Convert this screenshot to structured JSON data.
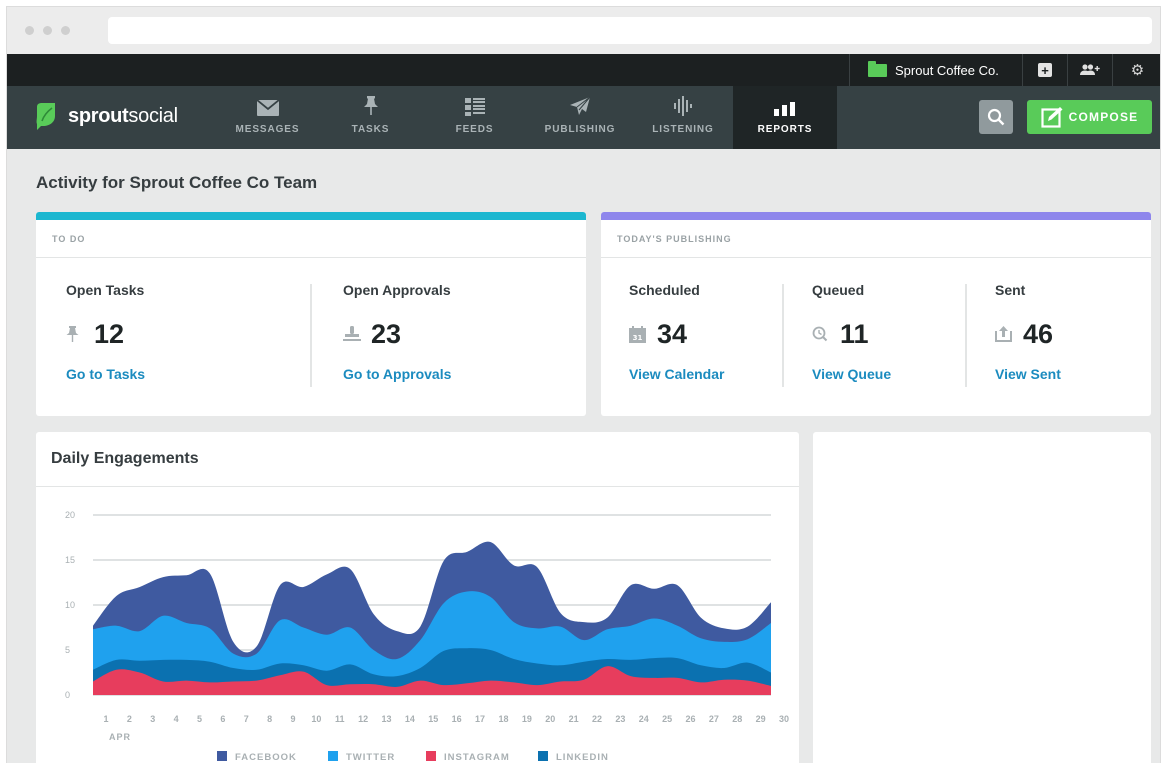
{
  "account": {
    "name": "Sprout Coffee Co."
  },
  "brand": {
    "name_bold": "sprout",
    "name_light": "social",
    "green": "#59cb59"
  },
  "nav": {
    "items": [
      {
        "label": "MESSAGES",
        "icon": "envelope-icon"
      },
      {
        "label": "TASKS",
        "icon": "pin-icon"
      },
      {
        "label": "FEEDS",
        "icon": "feeds-icon"
      },
      {
        "label": "PUBLISHING",
        "icon": "paper-plane-icon"
      },
      {
        "label": "LISTENING",
        "icon": "soundwave-icon"
      },
      {
        "label": "REPORTS",
        "icon": "bar-chart-icon",
        "active": true
      }
    ],
    "compose_label": "COMPOSE"
  },
  "page": {
    "title": "Activity for Sprout Coffee Co Team"
  },
  "todo": {
    "header": "TO DO",
    "accent": "#1cb7d0",
    "open_tasks": {
      "label": "Open Tasks",
      "value": "12",
      "link": "Go to Tasks"
    },
    "open_approvals": {
      "label": "Open Approvals",
      "value": "23",
      "link": "Go to Approvals"
    }
  },
  "publishing": {
    "header": "TODAY'S PUBLISHING",
    "accent": "#8e86ec",
    "scheduled": {
      "label": "Scheduled",
      "value": "34",
      "link": "View Calendar",
      "calendar_day": "31"
    },
    "queued": {
      "label": "Queued",
      "value": "11",
      "link": "View Queue"
    },
    "sent": {
      "label": "Sent",
      "value": "46",
      "link": "View Sent"
    }
  },
  "engagements": {
    "title": "Daily Engagements"
  },
  "chart_data": {
    "type": "area",
    "stacked": true,
    "x": [
      1,
      2,
      3,
      4,
      5,
      6,
      7,
      8,
      9,
      10,
      11,
      12,
      13,
      14,
      15,
      16,
      17,
      18,
      19,
      20,
      21,
      22,
      23,
      24,
      25,
      26,
      27,
      28,
      29,
      30
    ],
    "x_unit_label": "APR",
    "ylim": [
      0,
      20
    ],
    "yticks": [
      0,
      5,
      10,
      15,
      20
    ],
    "grid": true,
    "legend_position": "bottom",
    "series": [
      {
        "name": "INSTAGRAM",
        "color": "#e73d5d",
        "values": [
          1.5,
          2.8,
          2.5,
          1.5,
          1.6,
          1.4,
          1.5,
          1.6,
          2.2,
          2.6,
          1.1,
          1.2,
          1.2,
          0.9,
          1.6,
          1.1,
          1.3,
          1.6,
          1.4,
          1.1,
          1.5,
          1.7,
          3.2,
          2.1,
          1.9,
          1.9,
          1.4,
          1.7,
          1.6,
          1.0
        ]
      },
      {
        "name": "LINKEDIN",
        "color": "#0b71b0",
        "values": [
          1.3,
          1.1,
          1.3,
          2.4,
          2.3,
          2.3,
          1.5,
          1.2,
          1.3,
          0.7,
          1.6,
          2.2,
          1.1,
          1.2,
          1.4,
          3.8,
          3.9,
          3.4,
          2.6,
          2.4,
          1.8,
          2.0,
          0.8,
          1.8,
          2.2,
          2.2,
          1.9,
          1.3,
          2.0,
          1.5
        ]
      },
      {
        "name": "TWITTER",
        "color": "#1fa1ee",
        "values": [
          4.5,
          3.8,
          3.3,
          4.9,
          4.1,
          3.7,
          1.6,
          1.8,
          4.8,
          4.2,
          4.0,
          4.1,
          2.7,
          1.9,
          3.1,
          5.3,
          6.3,
          5.9,
          4.1,
          3.9,
          4.3,
          2.4,
          3.3,
          3.8,
          4.4,
          3.6,
          3.0,
          2.9,
          2.6,
          5.5
        ]
      },
      {
        "name": "FACEBOOK",
        "color": "#3f5aa0",
        "values": [
          0.4,
          3.3,
          4.9,
          4.3,
          5.3,
          6.1,
          1.3,
          0.8,
          3.9,
          4.5,
          6.7,
          6.5,
          4.0,
          3.1,
          1.5,
          4.7,
          4.4,
          6.1,
          6.3,
          6.8,
          1.5,
          2.0,
          1.3,
          4.5,
          3.3,
          4.5,
          2.3,
          1.5,
          1.4,
          2.3
        ]
      }
    ]
  }
}
